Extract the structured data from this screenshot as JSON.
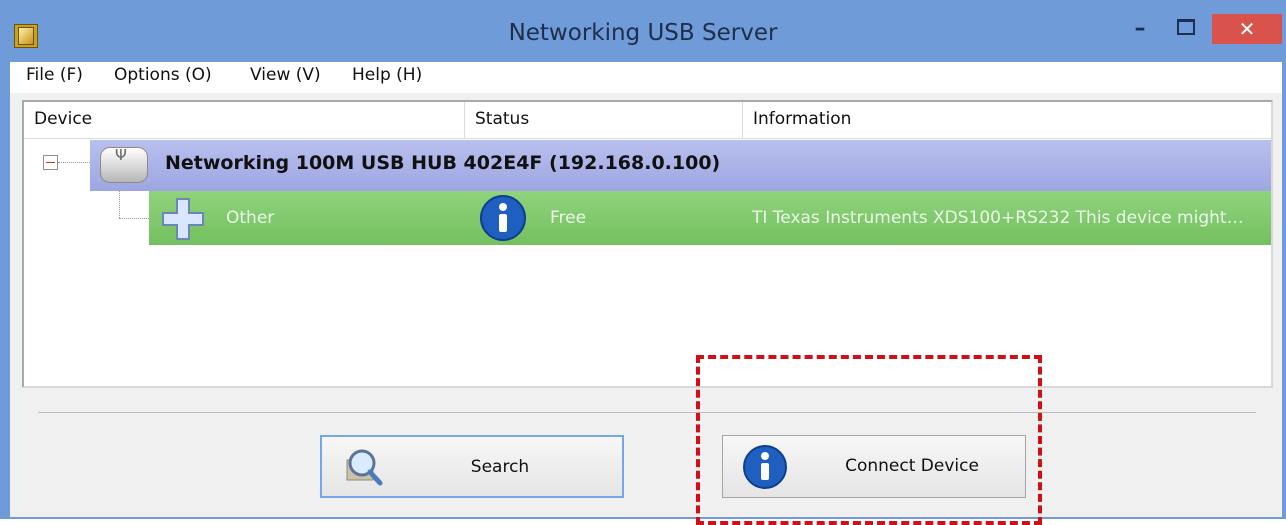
{
  "window": {
    "title": "Networking USB Server",
    "minimize": "–",
    "close": "✕"
  },
  "menu": {
    "items": [
      "File (F)",
      "Options (O)",
      "View (V)",
      "Help (H)"
    ]
  },
  "list": {
    "columns": [
      "Device",
      "Status",
      "Information"
    ],
    "hub": {
      "label": "Networking 100M USB HUB 402E4F  (192.168.0.100)"
    },
    "device": {
      "name": "Other",
      "status": "Free",
      "information": "TI Texas Instruments XDS100+RS232 This device might…"
    }
  },
  "buttons": {
    "search": "Search",
    "connect": "Connect Device"
  },
  "colors": {
    "hub_row": "#a9b0e8",
    "device_row": "#82c86d",
    "highlight": "#d10f16"
  }
}
